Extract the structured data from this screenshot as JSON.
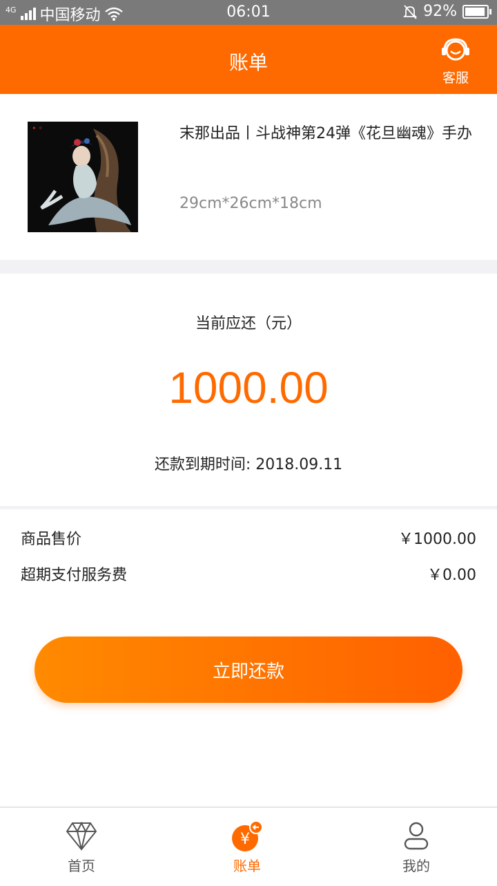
{
  "status": {
    "network": "4G",
    "carrier": "中国移动",
    "time": "06:01",
    "battery": "92%",
    "battery_level": 0.92
  },
  "header": {
    "title": "账单",
    "service_label": "客服"
  },
  "product": {
    "title": "末那出品丨斗战神第24弹《花旦幽魂》手办",
    "size": "29cm*26cm*18cm"
  },
  "due": {
    "label": "当前应还（元）",
    "amount": "1000.00",
    "date_text": "还款到期时间: 2018.09.11"
  },
  "fees": [
    {
      "label": "商品售价",
      "value": "￥1000.00"
    },
    {
      "label": "超期支付服务费",
      "value": "￥0.00"
    }
  ],
  "pay_button": "立即还款",
  "tabs": [
    {
      "label": "首页",
      "icon": "diamond-icon"
    },
    {
      "label": "账单",
      "icon": "yen-bill-icon"
    },
    {
      "label": "我的",
      "icon": "user-icon"
    }
  ],
  "colors": {
    "accent": "#ff6a00",
    "status_bar": "#7a7a7a",
    "separator": "#f2f2f5"
  }
}
